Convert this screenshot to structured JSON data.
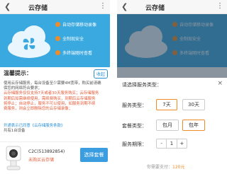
{
  "app": {
    "title": "云存储",
    "back_icon": "back-arrow-icon",
    "more_icon": "more-vertical-icon"
  },
  "colors": {
    "accent": "#3aa9df",
    "orange": "#f08c28",
    "red": "#e25b38"
  },
  "banner": {
    "features": [
      "自动存储移动录像",
      "全制现安全",
      "多终端随时查看"
    ]
  },
  "notice": {
    "title": "温馨提示：",
    "collapse_label": "收起",
    "body_lines": [
      "使用云存储服务，每台设备至少需要4M宽带，购买前请确",
      "保您的网络符合要求；",
      "云存储服务仅仅支持7天或者30天服务购买；云存储服务",
      "到期后如需继续使用，需续费购买，到期后云存储服务",
      "将停止；自动停止，服务不可以使用，如服务到期不续",
      "费服务，则会立即删除您的云存储录像；",
      "开通表示已同意《云存储服务条款》"
    ],
    "device_count": "共有1台设备"
  },
  "device": {
    "name": "C2C(513892854)",
    "status": "未购买云存储",
    "select_label": "选择套餐"
  },
  "dialog": {
    "title": "请选择服务类型：",
    "close": "×",
    "service_type_label": "服务类型：",
    "service_options": [
      "7天",
      "30天"
    ],
    "plan_type_label": "套餐类型：",
    "plan_options": [
      "包月",
      "包年"
    ],
    "period_label": "服务期限：",
    "stepper": {
      "minus": "-",
      "value": "1",
      "plus": "+"
    },
    "pay_label": "你需要支付：",
    "price": "120元"
  }
}
